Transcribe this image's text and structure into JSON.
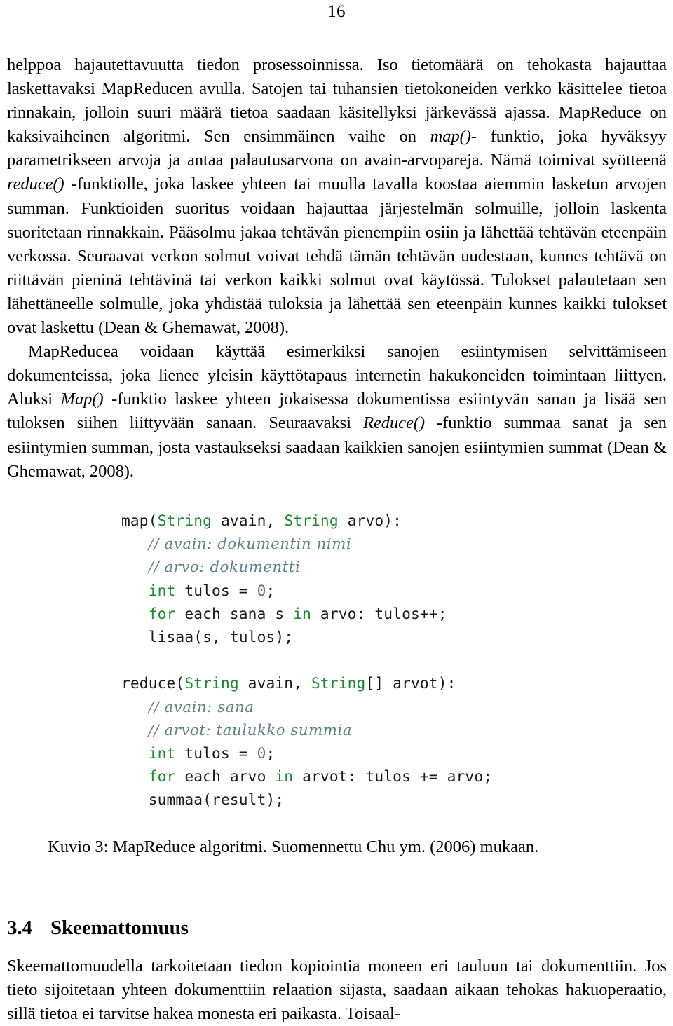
{
  "page": {
    "number": "16"
  },
  "body": {
    "paragraphs": [
      {
        "id": "para-mapreduce-intro",
        "indent": false,
        "runs": [
          {
            "text": "helppoa hajautettavuutta tiedon prosessoinnissa. Iso tietomäärä on tehokasta hajauttaa laskettavaksi MapReducen avulla. Satojen tai tuhansien tietokoneiden verkko käsittelee tietoa rinnakain, jolloin suuri määrä tietoa saadaan käsitellyksi järkevässä ajassa. MapReduce on kaksivaiheinen algoritmi. Sen ensimmäinen vaihe on ",
            "style": "normal"
          },
          {
            "text": "map()",
            "style": "italic"
          },
          {
            "text": "- funktio, joka hyväksyy parametrikseen arvoja ja antaa palautusarvona on avain-arvopareja. Nämä toimivat syötteenä ",
            "style": "normal"
          },
          {
            "text": "reduce()",
            "style": "italic"
          },
          {
            "text": " -funktiolle, joka laskee yhteen tai muulla tavalla koostaa aiemmin lasketun arvojen summan. Funktioiden suoritus voidaan hajauttaa järjestelmän solmuille, jolloin laskenta suoritetaan rinnakkain. Pääsolmu jakaa tehtävän pienempiin osiin ja lähettää tehtävän eteenpäin verkossa. Seuraavat verkon solmut voivat tehdä tämän tehtävän uudestaan, kunnes tehtävä on riittävän pieninä tehtävinä tai verkon kaikki solmut ovat käytössä. Tulokset palautetaan sen lähettäneelle solmulle, joka yhdistää tuloksia ja lähettää sen eteenpäin kunnes kaikki tulokset ovat laskettu (Dean & Ghemawat, 2008).",
            "style": "normal"
          }
        ]
      },
      {
        "id": "para-wordcount-example",
        "indent": true,
        "runs": [
          {
            "text": "MapReducea voidaan käyttää esimerkiksi sanojen esiintymisen selvittämiseen dokumenteissa, joka lienee yleisin käyttötapaus internetin hakukoneiden toimintaan liittyen. Aluksi ",
            "style": "normal"
          },
          {
            "text": "Map()",
            "style": "italic"
          },
          {
            "text": " -funktio laskee yhteen jokaisessa dokumentissa esiintyvän sanan ja lisää sen tuloksen siihen liittyvään sanaan. Seuraavaksi ",
            "style": "normal"
          },
          {
            "text": "Reduce()",
            "style": "italic"
          },
          {
            "text": " -funktio summaa sanat ja sen esiintymien summan, josta vastaukseksi saadaan kaikkien sanojen esiintymien summat (Dean & Ghemawat, 2008).",
            "style": "normal"
          }
        ]
      }
    ]
  },
  "code_listing": {
    "name": "mapreduce-pseudocode",
    "colors": {
      "keyword": "#188a2c",
      "comment": "#5c8289",
      "number": "#6f6f6f",
      "plain": "#1a1a1a"
    },
    "lines": [
      {
        "indent": 0,
        "tokens": [
          {
            "t": "map(",
            "c": "pln"
          },
          {
            "t": "String",
            "c": "kw"
          },
          {
            "t": " avain, ",
            "c": "pln"
          },
          {
            "t": "String",
            "c": "kw"
          },
          {
            "t": " arvo):",
            "c": "pln"
          }
        ]
      },
      {
        "indent": 1,
        "tokens": [
          {
            "t": "// avain: dokumentin nimi",
            "c": "cmt"
          }
        ]
      },
      {
        "indent": 1,
        "tokens": [
          {
            "t": "// arvo: dokumentti",
            "c": "cmt"
          }
        ]
      },
      {
        "indent": 1,
        "tokens": [
          {
            "t": "int",
            "c": "kw"
          },
          {
            "t": " tulos = ",
            "c": "pln"
          },
          {
            "t": "0",
            "c": "num"
          },
          {
            "t": ";",
            "c": "pln"
          }
        ]
      },
      {
        "indent": 1,
        "tokens": [
          {
            "t": "for",
            "c": "kw"
          },
          {
            "t": " each sana s ",
            "c": "pln"
          },
          {
            "t": "in",
            "c": "kw"
          },
          {
            "t": " arvo: tulos++;",
            "c": "pln"
          }
        ]
      },
      {
        "indent": 1,
        "tokens": [
          {
            "t": "lisaa(s, tulos);",
            "c": "pln"
          }
        ]
      },
      {
        "indent": 0,
        "tokens": []
      },
      {
        "indent": 0,
        "tokens": [
          {
            "t": "reduce(",
            "c": "pln"
          },
          {
            "t": "String",
            "c": "kw"
          },
          {
            "t": " avain, ",
            "c": "pln"
          },
          {
            "t": "String",
            "c": "kw"
          },
          {
            "t": "[] arvot):",
            "c": "pln"
          }
        ]
      },
      {
        "indent": 1,
        "tokens": [
          {
            "t": "// avain: sana",
            "c": "cmt"
          }
        ]
      },
      {
        "indent": 1,
        "tokens": [
          {
            "t": "// arvot: taulukko summia",
            "c": "cmt"
          }
        ]
      },
      {
        "indent": 1,
        "tokens": [
          {
            "t": "int",
            "c": "kw"
          },
          {
            "t": " tulos = ",
            "c": "pln"
          },
          {
            "t": "0",
            "c": "num"
          },
          {
            "t": ";",
            "c": "pln"
          }
        ]
      },
      {
        "indent": 1,
        "tokens": [
          {
            "t": "for",
            "c": "kw"
          },
          {
            "t": " each arvo ",
            "c": "pln"
          },
          {
            "t": "in",
            "c": "kw"
          },
          {
            "t": " arvot: tulos += arvo;",
            "c": "pln"
          }
        ]
      },
      {
        "indent": 1,
        "tokens": [
          {
            "t": "summaa(result);",
            "c": "pln"
          }
        ]
      }
    ]
  },
  "figure_caption": {
    "text": "Kuvio 3: MapReduce algoritmi. Suomennettu Chu ym. (2006) mukaan."
  },
  "section": {
    "number": "3.4",
    "title": "Skeemattomuus"
  },
  "tail": {
    "paragraphs": [
      {
        "id": "para-skeemattomuus",
        "indent": false,
        "runs": [
          {
            "text": "Skeemattomuudella tarkoitetaan tiedon kopiointia moneen eri tauluun tai dokumenttiin. Jos tieto sijoitetaan yhteen dokumenttiin relaation sijasta, saadaan aikaan tehokas hakuoperaatio, sillä tietoa ei tarvitse hakea monesta eri paikasta. Toisaal-",
            "style": "normal"
          }
        ]
      }
    ]
  }
}
